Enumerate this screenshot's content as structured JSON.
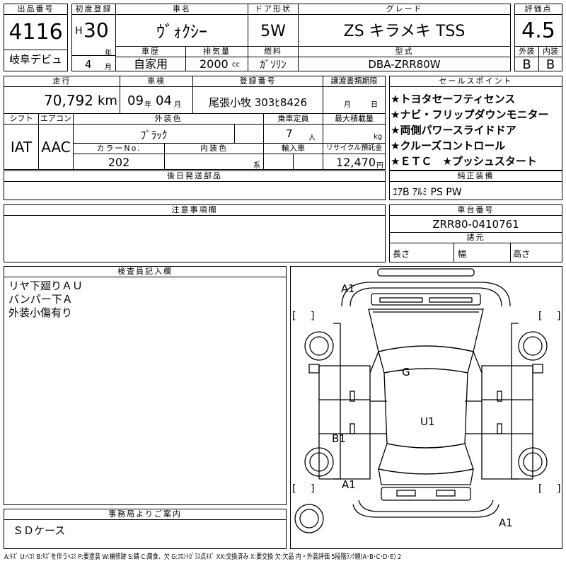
{
  "lot": {
    "label": "出品番号",
    "number": "4116",
    "venue": "岐阜デビュ"
  },
  "first_reg": {
    "label": "初度登録",
    "era": "H",
    "year": "30",
    "year_unit": "年",
    "month": "4",
    "month_unit": "月"
  },
  "car_name": {
    "label": "車名",
    "value": "ｳﾞｫｸｼｰ"
  },
  "door": {
    "label": "ドア形状",
    "value": "5W"
  },
  "grade": {
    "label": "グレード",
    "value": "ZS キラメキ TSS"
  },
  "score": {
    "label": "評価点",
    "value": "4.5",
    "ext_label": "外装",
    "ext_value": "B",
    "int_label": "内装",
    "int_value": "B"
  },
  "history": {
    "label": "車歴",
    "value": "自家用"
  },
  "displacement": {
    "label": "排気量",
    "value": "2000",
    "unit": "cc"
  },
  "fuel": {
    "label": "燃料",
    "value": "ｶﾞｿﾘﾝ"
  },
  "model_code": {
    "label": "型式",
    "value": "DBA-ZRR80W"
  },
  "mileage": {
    "label": "走行",
    "value": "70,792",
    "unit": "km"
  },
  "inspection": {
    "label": "車検",
    "year": "09",
    "year_unit": "年",
    "month": "04",
    "month_unit": "月"
  },
  "plate": {
    "label": "登録番号",
    "value": "尾張小牧 303ﾋ8426"
  },
  "transfer": {
    "label": "譲渡書類期限",
    "month_unit": "月",
    "day_unit": "日"
  },
  "shift": {
    "label": "シフト",
    "value": "IAT"
  },
  "aircon": {
    "label": "エアコン",
    "value": "AAC"
  },
  "exterior_color": {
    "label": "外装色",
    "value": "ﾌﾞﾗｯｸ"
  },
  "capacity": {
    "label": "乗車定員",
    "value": "7",
    "unit": "人"
  },
  "load": {
    "label": "最大積載量",
    "unit": "kg"
  },
  "color_no": {
    "label": "カラーNo.",
    "value": "202"
  },
  "interior_color": {
    "label": "内装色",
    "unit": "系"
  },
  "import": {
    "label": "輸入車"
  },
  "recycle": {
    "label": "リサイクル預託金",
    "value": "12,470",
    "unit": "円"
  },
  "sales_points": {
    "label": "セールスポイント",
    "items": [
      "★トヨタセーフティセンス",
      "★ナビ・フリップダウンモニター",
      "★両側パワースライドドア",
      "★クルーズコントロール",
      "★ＥＴＣ　★プッシュスタート"
    ]
  },
  "later_parts": {
    "label": "後日発送部品"
  },
  "equipment": {
    "label": "純正装備",
    "value": "ｴｱB ｱﾙﾐ PS PW"
  },
  "notes": {
    "label": "注意事項欄"
  },
  "chassis": {
    "label": "車台番号",
    "value": "ZRR80-0410761"
  },
  "dimensions": {
    "label": "諸元",
    "length": "長さ",
    "width": "幅",
    "height": "高さ"
  },
  "inspector": {
    "label": "検査員記入欄",
    "lines": [
      "リヤ下廻りＡＵ",
      "バンパー下Ａ",
      "外装小傷有り"
    ]
  },
  "office": {
    "label": "事務局よりご案内",
    "text": "ＳＤケース"
  },
  "diagram": {
    "marks": {
      "a1_top": "A1",
      "g": "G",
      "u1": "U1",
      "b1": "B1",
      "a1_left": "A1",
      "a1_bottom": "A1"
    },
    "bracket_open": "[",
    "bracket_close": "]"
  },
  "legend": "A:ｷｽﾞ U:ﾍｺﾐ B:ｷｽﾞを伴うﾍｺﾐ P:要塗装 W:補修跡 S:錆 C:腐食、欠 G:ﾌﾛﾝﾄｶﾞﾗｽ点ｷｽﾞ XX:交換済み X:要交換 欠:欠品 内・外装評価 5段階ﾗﾝｸ順(A･B･C･D･E) 2"
}
